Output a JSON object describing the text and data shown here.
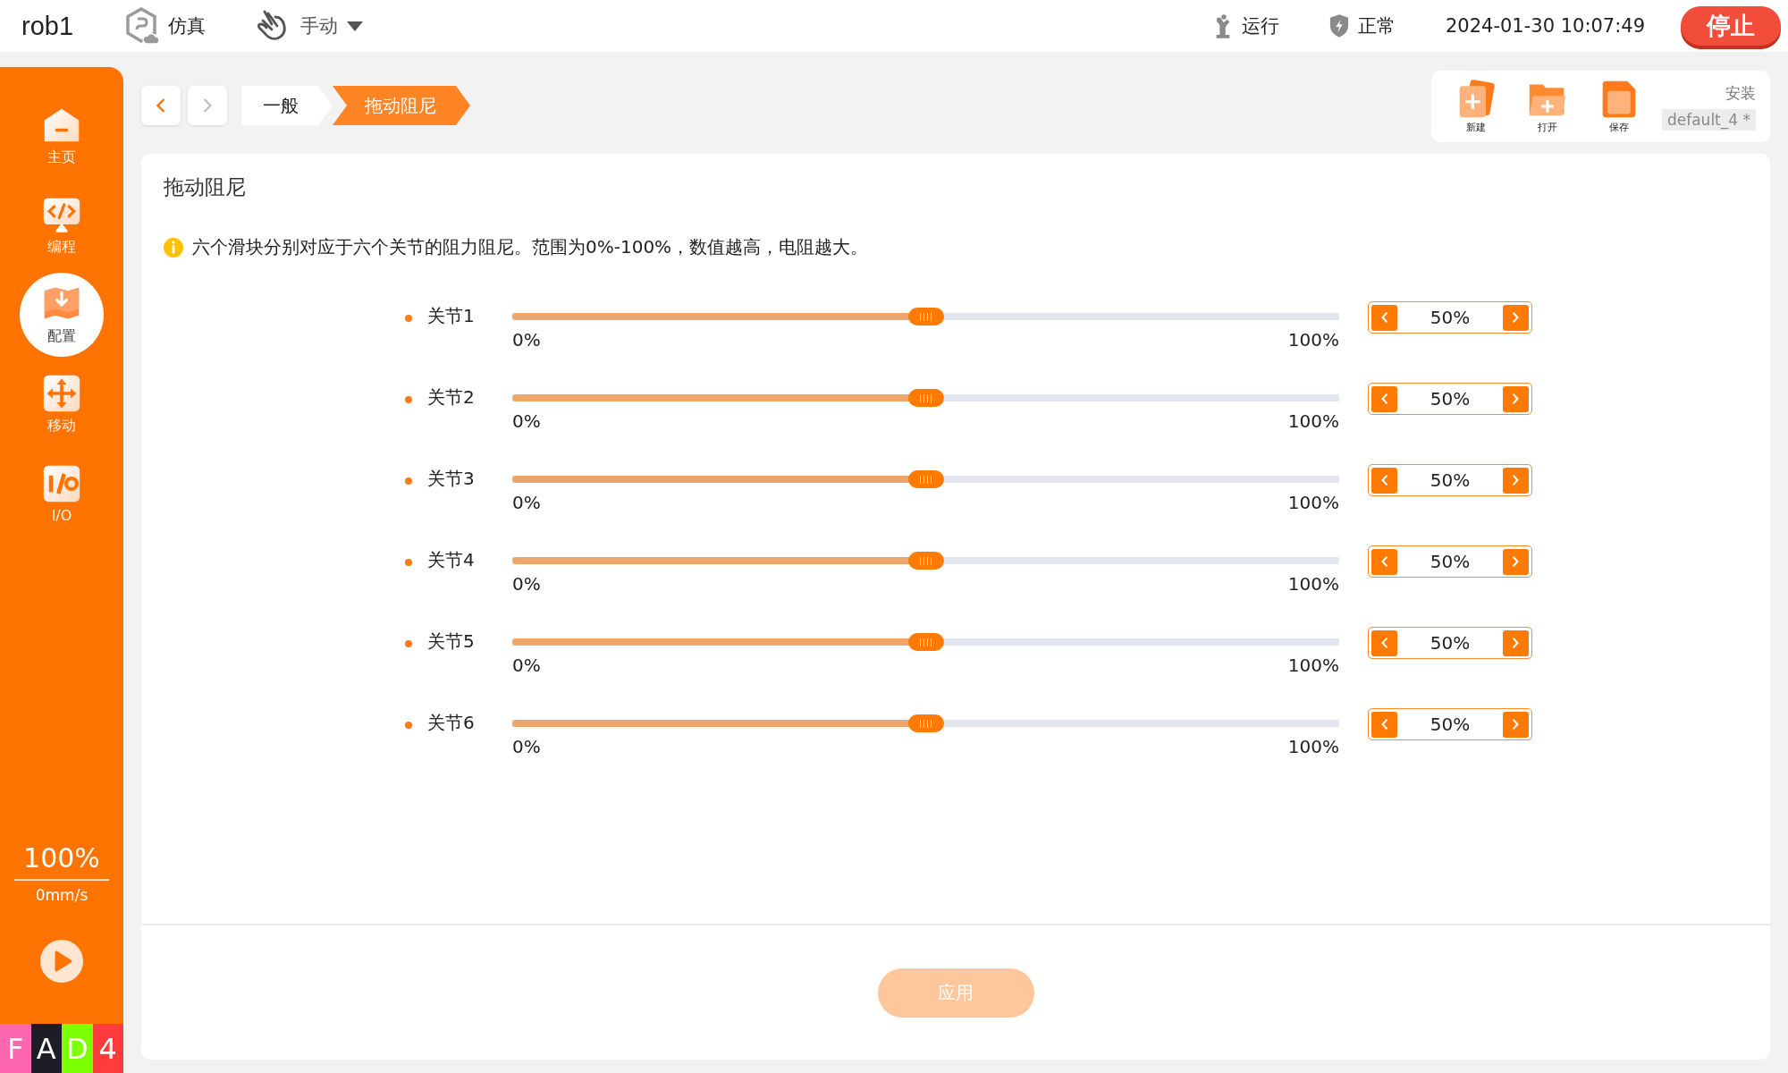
{
  "top_bar": {
    "robot_name": "rob1",
    "simulation": {
      "label": "仿真"
    },
    "mode": {
      "label": "手动"
    },
    "run_state": {
      "label": "运行"
    },
    "safety": {
      "label": "正常"
    },
    "datetime": "2024-01-30 10:07:49",
    "stop_button": "停止"
  },
  "sidebar": {
    "items": [
      {
        "kind": "home",
        "label": "主页",
        "selected": false
      },
      {
        "kind": "code",
        "label": "编程",
        "selected": false
      },
      {
        "kind": "config",
        "label": "配置",
        "selected": true
      },
      {
        "kind": "move",
        "label": "移动",
        "selected": false
      },
      {
        "kind": "io",
        "label": "I/O",
        "selected": false
      }
    ],
    "speed": "100%",
    "velocity": "0mm/s",
    "badges": [
      {
        "label": "F",
        "color": "#ff66b0"
      },
      {
        "label": "A",
        "color": "#1c1d26"
      },
      {
        "label": "D",
        "color": "#7cff00"
      },
      {
        "label": "4",
        "color": "#ff3b3b"
      }
    ]
  },
  "breadcrumb": [
    {
      "label": "一般",
      "selected": false
    },
    {
      "label": "拖动阻尼",
      "selected": true
    }
  ],
  "toolbar": {
    "actions": [
      {
        "kind": "new",
        "label": "新建"
      },
      {
        "kind": "open",
        "label": "打开"
      },
      {
        "kind": "save",
        "label": "保存"
      }
    ],
    "installation_label": "安装",
    "installation_name": "default_4 *"
  },
  "panel": {
    "title": "拖动阻尼",
    "info": "六个滑块分别对应于六个关节的阻力阻尼。范围为0%-100%，数值越高，电阻越大。",
    "joints": [
      {
        "name": "关节1",
        "level": 0.5,
        "min": "0%",
        "max": "100%",
        "value": "50%"
      },
      {
        "name": "关节2",
        "level": 0.5,
        "min": "0%",
        "max": "100%",
        "value": "50%"
      },
      {
        "name": "关节3",
        "level": 0.5,
        "min": "0%",
        "max": "100%",
        "value": "50%"
      },
      {
        "name": "关节4",
        "level": 0.5,
        "min": "0%",
        "max": "100%",
        "value": "50%"
      },
      {
        "name": "关节5",
        "level": 0.5,
        "min": "0%",
        "max": "100%",
        "value": "50%"
      },
      {
        "name": "关节6",
        "level": 0.5,
        "min": "0%",
        "max": "100%",
        "value": "50%"
      }
    ],
    "apply_button": {
      "label": "应用",
      "disabled": true
    }
  }
}
